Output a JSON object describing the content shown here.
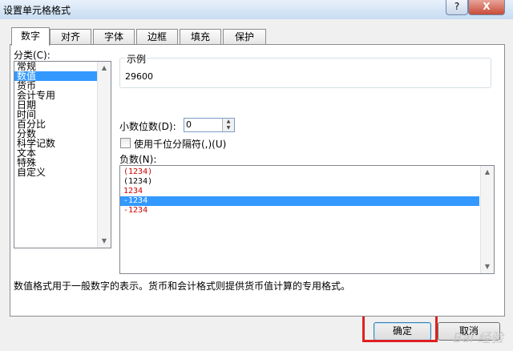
{
  "window": {
    "title": "设置单元格格式",
    "help_label": "?",
    "close_label": "X"
  },
  "tabs": [
    {
      "label": "数字",
      "active": true
    },
    {
      "label": "对齐",
      "active": false
    },
    {
      "label": "字体",
      "active": false
    },
    {
      "label": "边框",
      "active": false
    },
    {
      "label": "填充",
      "active": false
    },
    {
      "label": "保护",
      "active": false
    }
  ],
  "category": {
    "label": "分类(C):",
    "items": [
      "常规",
      "数值",
      "货币",
      "会计专用",
      "日期",
      "时间",
      "百分比",
      "分数",
      "科学记数",
      "文本",
      "特殊",
      "自定义"
    ],
    "selected": "数值"
  },
  "sample": {
    "legend": "示例",
    "value": "29600"
  },
  "decimal": {
    "label": "小数位数(D):",
    "value": "0"
  },
  "thousands": {
    "label": "使用千位分隔符(,)(U)",
    "checked": false
  },
  "negative": {
    "label": "负数(N):",
    "items": [
      {
        "text": "(1234)",
        "color": "#cc0000"
      },
      {
        "text": "(1234)",
        "color": "#000000"
      },
      {
        "text": "1234",
        "color": "#cc0000"
      },
      {
        "text": "-1234",
        "color": "#000000",
        "selected": true
      },
      {
        "text": "-1234",
        "color": "#cc0000"
      }
    ]
  },
  "description": "数值格式用于一般数字的表示。货币和会计格式则提供货币值计算的专用格式。",
  "buttons": {
    "ok": "确定",
    "cancel": "取消"
  },
  "colors": {
    "selection": "#3399ff",
    "highlight_box": "#e02020",
    "negative_red": "#cc0000"
  },
  "watermark": "Baidu 经验"
}
